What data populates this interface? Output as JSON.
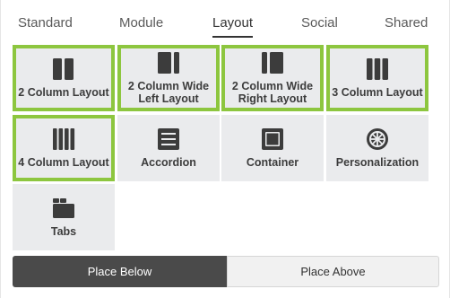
{
  "tabs": [
    {
      "label": "Standard"
    },
    {
      "label": "Module"
    },
    {
      "label": "Layout"
    },
    {
      "label": "Social"
    },
    {
      "label": "Shared"
    }
  ],
  "active_tab": "Layout",
  "tiles": [
    {
      "label_line1": "2 Column Layout",
      "label_line2": "",
      "icon": "two-column-icon",
      "selected": true
    },
    {
      "label_line1": "2 Column Wide",
      "label_line2": "Left Layout",
      "icon": "two-column-wide-left-icon",
      "selected": true
    },
    {
      "label_line1": "2 Column Wide",
      "label_line2": "Right Layout",
      "icon": "two-column-wide-right-icon",
      "selected": true
    },
    {
      "label_line1": "3 Column Layout",
      "label_line2": "",
      "icon": "three-column-icon",
      "selected": true
    },
    {
      "label_line1": "4 Column Layout",
      "label_line2": "",
      "icon": "four-column-icon",
      "selected": true
    },
    {
      "label_line1": "Accordion",
      "label_line2": "",
      "icon": "accordion-icon",
      "selected": false
    },
    {
      "label_line1": "Container",
      "label_line2": "",
      "icon": "container-icon",
      "selected": false
    },
    {
      "label_line1": "Personalization",
      "label_line2": "",
      "icon": "personalization-icon",
      "selected": false
    },
    {
      "label_line1": "Tabs",
      "label_line2": "",
      "icon": "tabs-icon",
      "selected": false
    }
  ],
  "buttons": {
    "place_below": "Place Below",
    "place_above": "Place Above"
  },
  "colors": {
    "selected_border": "#8dc63f",
    "tile_bg": "#eaebed",
    "icon": "#3c3c3c",
    "primary_button": "#4a4a4a"
  }
}
